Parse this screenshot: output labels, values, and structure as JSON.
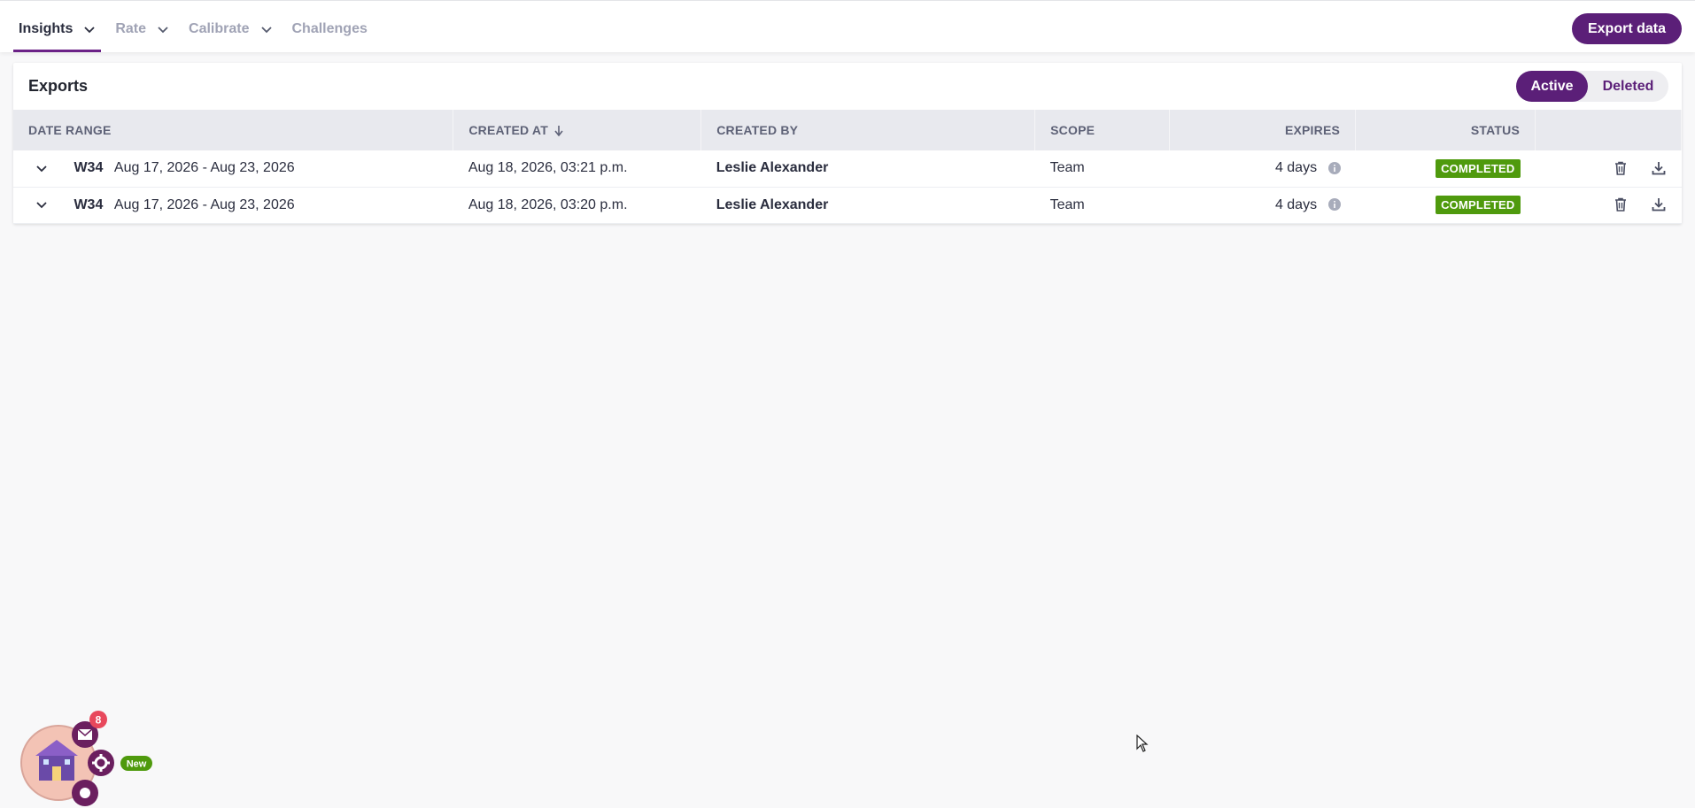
{
  "nav": {
    "items": [
      {
        "label": "Insights",
        "active": true,
        "has_menu": true
      },
      {
        "label": "Rate",
        "active": false,
        "has_menu": true
      },
      {
        "label": "Calibrate",
        "active": false,
        "has_menu": true
      },
      {
        "label": "Challenges",
        "active": false,
        "has_menu": false
      }
    ],
    "export_button": "Export data"
  },
  "exports": {
    "title": "Exports",
    "toggle": {
      "active": "Active",
      "deleted": "Deleted",
      "selected": "Active"
    },
    "columns": {
      "date_range": "DATE RANGE",
      "created_at": "CREATED AT",
      "created_by": "CREATED BY",
      "scope": "SCOPE",
      "expires": "EXPIRES",
      "status": "STATUS"
    },
    "sort_indicator": "arrow-down-icon",
    "rows": [
      {
        "week": "W34",
        "range": "Aug 17, 2026 - Aug 23, 2026",
        "created_at": "Aug 18, 2026, 03:21 p.m.",
        "created_by": "Leslie Alexander",
        "scope": "Team",
        "expires": "4 days",
        "status": "COMPLETED"
      },
      {
        "week": "W34",
        "range": "Aug 17, 2026 - Aug 23, 2026",
        "created_at": "Aug 18, 2026, 03:20 p.m.",
        "created_by": "Leslie Alexander",
        "scope": "Team",
        "expires": "4 days",
        "status": "COMPLETED"
      }
    ]
  },
  "widget": {
    "notification_count": "8",
    "new_badge": "New"
  },
  "colors": {
    "brand": "#5b1f78",
    "status_completed": "#4f9a0d",
    "badge_red": "#e8485c"
  }
}
